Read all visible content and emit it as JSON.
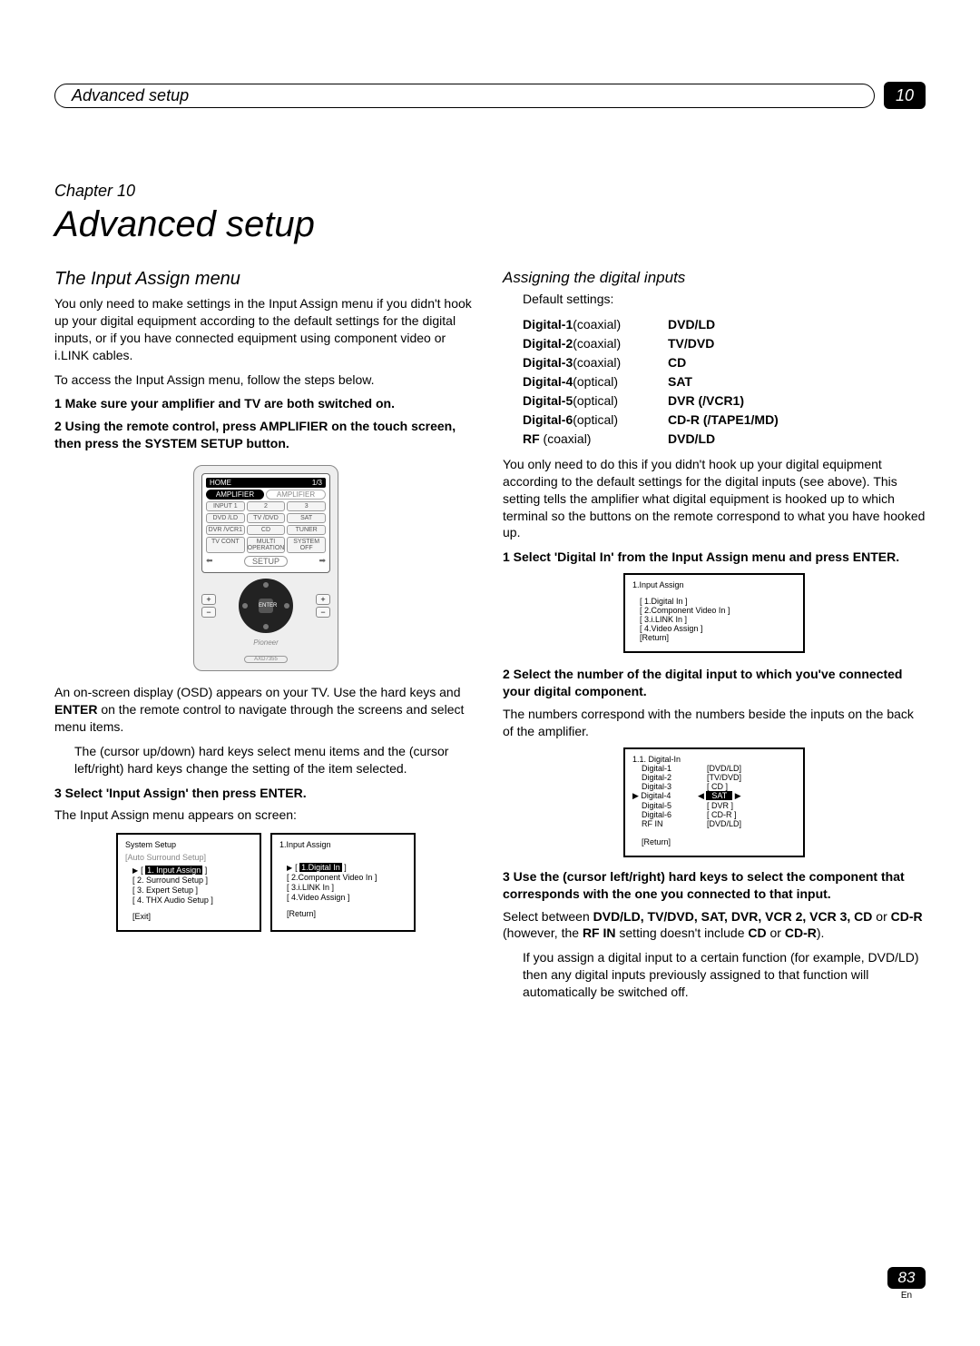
{
  "header": {
    "breadcrumb": "Advanced setup",
    "chapter_num": "10"
  },
  "chapter": {
    "label": "Chapter 10",
    "title": "Advanced setup"
  },
  "left": {
    "h2": "The Input Assign menu",
    "p1": "You only need to make settings in the Input Assign menu if you didn't hook up your digital equipment according to the default settings for the digital inputs, or if you have connected equipment using component video or i.LINK cables.",
    "p2": "To access the Input Assign menu, follow the steps below.",
    "step1": "1   Make sure your amplifier and TV are both switched on.",
    "step2": "2   Using the remote control, press AMPLIFIER on the touch screen, then press the SYSTEM SETUP button.",
    "p3a": "An on-screen display (OSD) appears on your TV. Use the",
    "p3b": "hard keys and ",
    "p3b_bold": "ENTER",
    "p3c": " on the remote control to navigate through the screens and select menu items.",
    "bullet1a": "The        (cursor up/down) hard keys select menu items and the          (cursor left/right) hard keys change the setting of the item selected.",
    "step3": "3   Select 'Input Assign' then press ENTER.",
    "p4": "The Input Assign menu appears on screen:"
  },
  "remote": {
    "home": "HOME",
    "page": "1/3",
    "amp_on": "AMPLIFIER",
    "amp_off": "AMPLIFIER",
    "grid": [
      "INPUT 1",
      "2",
      "3",
      "DVD /LD",
      "TV /DVD",
      "SAT",
      "DVR /VCR1",
      "CD",
      "TUNER",
      "TV CONT",
      "MULTI OPERATION",
      "SYSTEM OFF"
    ],
    "setup": "SETUP",
    "enter": "ENTER",
    "brand": "Pioneer",
    "model": "AXD7355"
  },
  "osd_left1": {
    "title": "System Setup",
    "grey": "[Auto Surround Setup]",
    "items": [
      "1. Input Assign",
      "[ 2. Surround Setup ]",
      "[ 3. Expert Setup ]",
      "[ 4. THX Audio Setup ]"
    ],
    "ret": "[Exit]"
  },
  "osd_left2": {
    "title": "1.Input Assign",
    "items": [
      "1.Digital In",
      "[ 2.Component Video In ]",
      "[ 3.i.LINK In ]",
      "[ 4.Video Assign ]"
    ],
    "ret": "[Return]"
  },
  "right": {
    "h3": "Assigning the digital inputs",
    "defaults_label": "Default settings:",
    "defaults": [
      {
        "k": "Digital-1",
        "t": "(coaxial)",
        "v": "DVD/LD"
      },
      {
        "k": "Digital-2",
        "t": "(coaxial)",
        "v": "TV/DVD"
      },
      {
        "k": "Digital-3",
        "t": "(coaxial)",
        "v": "CD"
      },
      {
        "k": "Digital-4",
        "t": "(optical)",
        "v": "SAT"
      },
      {
        "k": "Digital-5",
        "t": "(optical)",
        "v": "DVR (/VCR1)"
      },
      {
        "k": "Digital-6",
        "t": "(optical)",
        "v": "CD-R (/TAPE1/MD)"
      },
      {
        "k": "   RF",
        "t": " (coaxial)",
        "v": "DVD/LD"
      }
    ],
    "p1": "You only need to do this if you didn't hook up your digital equipment according to the default settings for the digital inputs (see above). This setting tells the amplifier what digital equipment is hooked up to which terminal so the buttons on the remote correspond to what you have hooked up.",
    "step1": "1   Select 'Digital In' from the Input Assign menu and press ENTER.",
    "step2": "2   Select the number of the digital input to which you've connected your digital component.",
    "p2": "The numbers correspond with the numbers beside the inputs on the back of the amplifier.",
    "step3": "3   Use the          (cursor left/right) hard keys to select the component that corresponds with the one you connected to that input.",
    "p3a": "Select between ",
    "p3_list": "DVD/LD, TV/DVD, SAT, DVR, VCR 2, VCR 3, CD",
    "p3b": " or ",
    "p3_cdr": "CD-R",
    "p3c": " (however, the ",
    "p3_rf": "RF IN",
    "p3d": " setting doesn't include ",
    "p3_cd": "CD",
    "p3e": " or ",
    "p3_cdr2": "CD-R",
    "p3f": ").",
    "bullet": "If you assign a digital input to a certain function (for example, DVD/LD) then any digital inputs previously assigned to that function will automatically be switched off."
  },
  "osd_r1": {
    "title": "1.Input Assign",
    "items": [
      "1.Digital In",
      "[ 2.Component Video In ]",
      "[ 3.i.LINK In ]",
      "[ 4.Video Assign ]"
    ],
    "ret": "[Return]"
  },
  "osd_r2": {
    "title": "1.1. Digital-In",
    "rows": [
      {
        "lbl": "Digital-1",
        "val": "[DVD/LD]"
      },
      {
        "lbl": "Digital-2",
        "val": "[TV/DVD]"
      },
      {
        "lbl": "Digital-3",
        "val": "[  CD  ]"
      },
      {
        "lbl": "Digital-4",
        "val": "SAT",
        "sel": true
      },
      {
        "lbl": "Digital-5",
        "val": "[  DVR  ]"
      },
      {
        "lbl": "Digital-6",
        "val": "[  CD-R  ]"
      },
      {
        "lbl": "RF  IN",
        "val": "[DVD/LD]"
      }
    ],
    "ret": "[Return]"
  },
  "footer": {
    "page": "83",
    "lang": "En"
  }
}
